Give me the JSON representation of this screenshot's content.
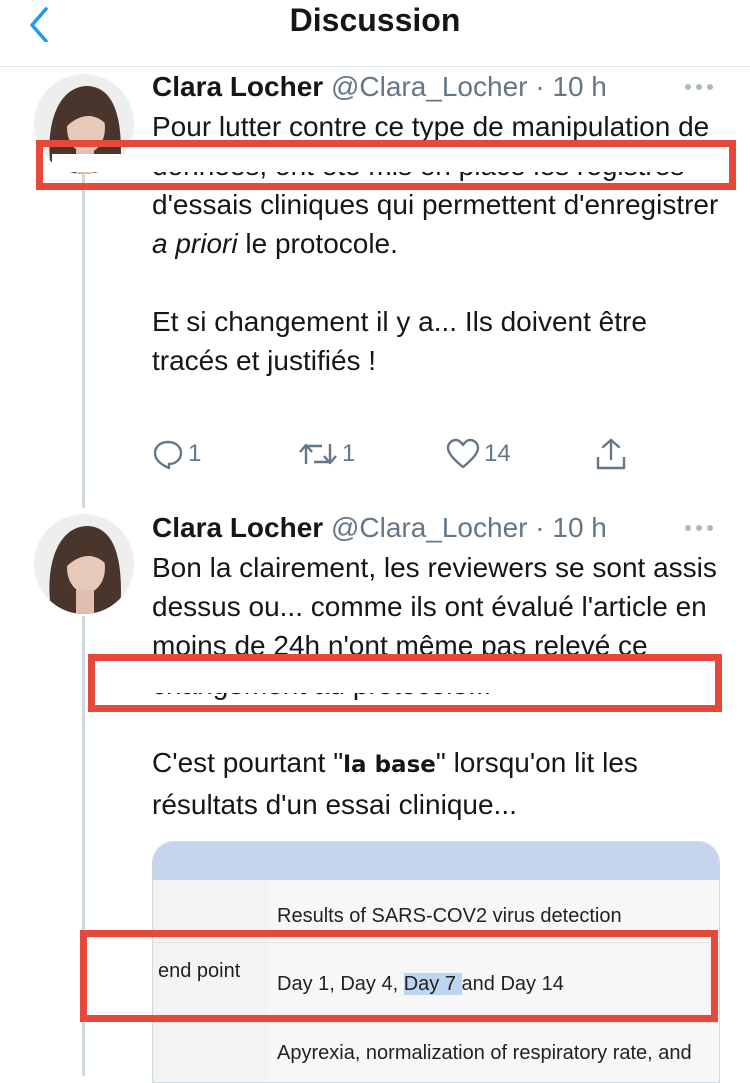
{
  "nav": {
    "title": "Discussion",
    "back_icon": "chevron-left-icon",
    "back_color": "#1d9bf0"
  },
  "tweets": [
    {
      "author": "Clara Locher",
      "handle": "@Clara_Locher",
      "time": "· 10 h",
      "p1_a": "Pour lutter contre ce type de manipulation de données, ont été mis en place les registres d'essais cliniques qui permettent d'enregistrer ",
      "p1_em": "a priori",
      "p1_b": " le protocole.",
      "p2": "Et si changement il y a... Ils doivent être tracés et justifiés !",
      "replies": "1",
      "retweets": "1",
      "likes": "14"
    },
    {
      "author": "Clara Locher",
      "handle": "@Clara_Locher",
      "time": "· 10 h",
      "p1": "Bon la clairement, les reviewers se sont assis dessus ou... comme ils ont évalué l'article en moins de 24h n'ont même pas relevé ce changement au protocole...",
      "p2_a": "C'est pourtant \"",
      "p2_b": "la base",
      "p2_c": "\" lorsqu'on lit les résultats d'un essai clinique..."
    }
  ],
  "card": {
    "row1_right": "Results of SARS-COV2 virus detection",
    "row2_left": "end point",
    "row2_right_a": "Day 1, Day 4, ",
    "row2_right_hl": "Day 7 ",
    "row2_right_b": "and Day 14",
    "row3_right": "Apyrexia, normalization of respiratory rate, and"
  },
  "colors": {
    "annotation_red": "#e5493a",
    "text_secondary": "#657786",
    "card_header": "#c5d5ee",
    "highlight": "#bcd6f2"
  }
}
